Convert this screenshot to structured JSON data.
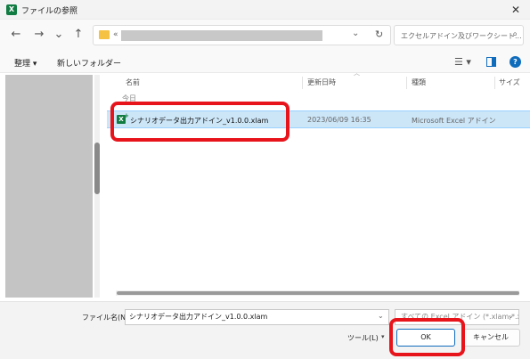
{
  "window": {
    "title": "ファイルの参照",
    "close_glyph": "✕"
  },
  "nav": {
    "back": "←",
    "forward": "→",
    "recent": "⌄",
    "up": "↑"
  },
  "address": {
    "prefix": "«",
    "chevron": "⌄",
    "refresh": "↻"
  },
  "search": {
    "placeholder": "エクセルアドイン及びワークシート...",
    "icon": "⌕"
  },
  "toolbar": {
    "organize": "整理 ▾",
    "new_folder": "新しいフォルダー",
    "view_icon": "☰ ▾",
    "help": "?"
  },
  "columns": {
    "name": "名前",
    "modified": "更新日時",
    "type": "種類",
    "size": "サイズ"
  },
  "group_label": "今日",
  "file": {
    "name": "シナリオデータ出力アドイン_v1.0.0.xlam",
    "modified": "2023/06/09 16:35",
    "type": "Microsoft Excel アドイン"
  },
  "bottom": {
    "filename_label": "ファイル名(N):",
    "filename_value": "シナリオデータ出力アドイン_v1.0.0.xlam",
    "filter_value": "すべての Excel アドイン (*.xlam;*.xla;*.xll)",
    "tools_label": "ツール(L)",
    "tools_caret": "▾",
    "ok_label": "OK",
    "cancel_label": "キャンセル"
  },
  "colors": {
    "highlight": "#e8141c",
    "selection": "#cce6f8",
    "accent": "#0f6cbd",
    "excel_green": "#107c41"
  }
}
